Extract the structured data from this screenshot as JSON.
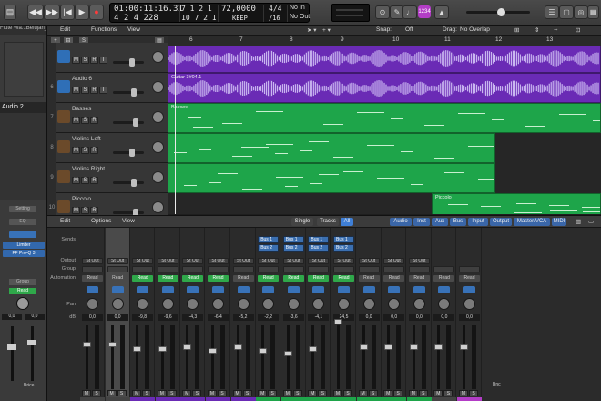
{
  "control_bar": {
    "transport": [
      "rewind-button",
      "forward-button",
      "go-to-start-button",
      "play-button",
      "record-button",
      "cycle-button"
    ],
    "lcd": {
      "time": "01:00:11:16.31",
      "bars": "4 2 4 228",
      "pos_top_right": "7 1 2 1",
      "pos_bottom_right": "10 7 2 1",
      "tempo": "72,0000",
      "tempo_mode": "KEEP",
      "sig_top": "4/4",
      "sig_bottom": "/16",
      "in": "No In",
      "out": "No Out"
    },
    "badge": "1234",
    "colors": {
      "badge": "#b33dc6",
      "accent": "#3f7fd6"
    }
  },
  "inspector": {
    "region_label": "Flute Wa...Belujah_1",
    "track_label": "Audio 2",
    "setting_label": "Setting",
    "eq_label": "EQ",
    "plugin1": "Limiter",
    "plugin2": "FF Pro-Q 3",
    "group_label": "Group",
    "read_label": "Read",
    "db_left": "0,0",
    "db_right": "0,0",
    "strip_name": "Brice"
  },
  "tracks_toolbar": {
    "edit": "Edit",
    "functions": "Functions",
    "view": "View",
    "snap_label": "Snap:",
    "snap_value": "Off",
    "drag_label": "Drag:",
    "drag_value": "No Overlap"
  },
  "ruler": {
    "bars": [
      "6",
      "7",
      "8",
      "9",
      "10",
      "11",
      "12",
      "13"
    ]
  },
  "tracks": [
    {
      "num": "",
      "name": "",
      "type": "audio"
    },
    {
      "num": "6",
      "name": "Audio 6",
      "type": "audio"
    },
    {
      "num": "7",
      "name": "Basses",
      "type": "midi"
    },
    {
      "num": "8",
      "name": "Violins Left",
      "type": "midi"
    },
    {
      "num": "9",
      "name": "Violins Right",
      "type": "midi"
    },
    {
      "num": "10",
      "name": "Piccolo",
      "type": "midi"
    }
  ],
  "track_buttons": {
    "m": "M",
    "s": "S",
    "r": "R",
    "i": "I"
  },
  "regions": [
    {
      "name": "",
      "color": "#6a2bb5"
    },
    {
      "name": "Guitar 3#04.1",
      "color": "#6a2bb5"
    },
    {
      "name": "Basses",
      "color": "#1ea54a"
    },
    {
      "name": "",
      "color": "#1ea54a"
    },
    {
      "name": "",
      "color": "#1ea54a"
    },
    {
      "name": "Piccolo",
      "color": "#1ea54a"
    }
  ],
  "mixer_bar": {
    "edit": "Edit",
    "options": "Options",
    "view": "View",
    "single": "Single",
    "tracks": "Tracks",
    "all": "All",
    "filters": [
      "Audio",
      "Inst",
      "Aux",
      "Bus",
      "Input",
      "Output",
      "Master/VCA",
      "MIDI"
    ]
  },
  "mixer_rows": {
    "sends": "Sends",
    "output": "Output",
    "group": "Group",
    "automation": "Automation",
    "pan": "Pan",
    "db": "dB"
  },
  "strips": [
    {
      "output": "St Out",
      "read": "Read",
      "read_on": false,
      "db": "0,0",
      "buses": [],
      "color": "#444"
    },
    {
      "output": "St Out",
      "read": "Read",
      "read_on": false,
      "db": "0,0",
      "buses": [],
      "color": "#444"
    },
    {
      "output": "St Out",
      "read": "Read",
      "read_on": true,
      "db": "-9,8",
      "buses": [],
      "color": "#6a2bb5"
    },
    {
      "output": "St Out",
      "read": "Read",
      "read_on": true,
      "db": "-9,6",
      "buses": [],
      "color": "#6a2bb5"
    },
    {
      "output": "St Out",
      "read": "Read",
      "read_on": true,
      "db": "-4,3",
      "buses": [],
      "color": "#6a2bb5"
    },
    {
      "output": "St Out",
      "read": "Read",
      "read_on": true,
      "db": "-6,4",
      "buses": [],
      "color": "#6a2bb5"
    },
    {
      "output": "St Out",
      "read": "Read",
      "read_on": false,
      "db": "-5,2",
      "buses": [],
      "color": "#6a2bb5"
    },
    {
      "output": "St Out",
      "read": "Read",
      "read_on": true,
      "db": "-2,2",
      "buses": [
        "Bus 1",
        "Bus 2"
      ],
      "color": "#1ea54a"
    },
    {
      "output": "St Out",
      "read": "Read",
      "read_on": true,
      "db": "-3,6",
      "buses": [
        "Bus 1",
        "Bus 2"
      ],
      "color": "#1ea54a"
    },
    {
      "output": "St Out",
      "read": "Read",
      "read_on": true,
      "db": "-4,1",
      "buses": [
        "Bus 1",
        "Bus 2"
      ],
      "color": "#1ea54a"
    },
    {
      "output": "St Out",
      "read": "Read",
      "read_on": true,
      "db": "24,5",
      "buses": [
        "Bus 1",
        "Bus 2"
      ],
      "color": "#1ea54a"
    },
    {
      "output": "St Out",
      "read": "Read",
      "read_on": false,
      "db": "0,0",
      "buses": [],
      "color": "#1ea54a"
    },
    {
      "output": "St Out",
      "read": "Read",
      "read_on": false,
      "db": "0,0",
      "buses": [],
      "color": "#1ea54a"
    },
    {
      "output": "St Out",
      "read": "Read",
      "read_on": false,
      "db": "0,0",
      "buses": [],
      "color": "#1ea54a"
    },
    {
      "output": "",
      "read": "Read",
      "read_on": false,
      "db": "0,0",
      "buses": [],
      "color": "#444"
    },
    {
      "output": "",
      "read": "Read",
      "read_on": false,
      "db": "0,0",
      "buses": [],
      "color": "#b33dc6"
    }
  ],
  "strip_extra": {
    "bnc": "Bnc"
  }
}
